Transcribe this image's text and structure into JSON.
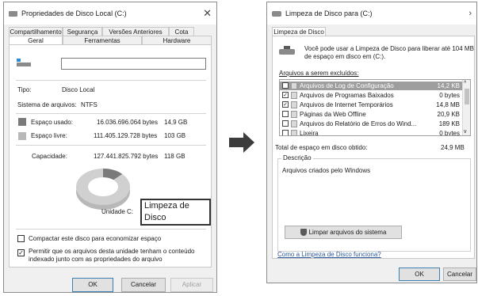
{
  "left": {
    "title": "Propriedades de Disco Local (C:)",
    "tabs_top": [
      "Compartilhamento",
      "Segurança",
      "Versões Anteriores",
      "Cota"
    ],
    "tabs_bottom": [
      "Geral",
      "Ferramentas",
      "Hardware"
    ],
    "type_label": "Tipo:",
    "type_value": "Disco Local",
    "fs_label": "Sistema de arquivos:",
    "fs_value": "NTFS",
    "used_label": "Espaço usado:",
    "used_bytes": "16.036.696.064 bytes",
    "used_gb": "14,9 GB",
    "free_label": "Espaço livre:",
    "free_bytes": "111.405.129.728 bytes",
    "free_gb": "103 GB",
    "cap_label": "Capacidade:",
    "cap_bytes": "127.441.825.792 bytes",
    "cap_gb": "118 GB",
    "unit_label": "Unidade C:",
    "cleanup_button": "Limpeza de Disco",
    "compress_label": "Compactar este disco para economizar espaço",
    "index_label_1": "Permitir que os arquivos desta unidade tenham o conteúdo",
    "index_label_2": "indexado junto com as propriedades do arquivo",
    "ok": "OK",
    "cancel": "Cancelar",
    "apply": "Aplicar"
  },
  "right": {
    "title": "Limpeza de Disco para  (C:)",
    "tab": "Limpeza de Disco",
    "intro_1": "Você pode usar a Limpeza de Disco para liberar até 104 MB",
    "intro_2": "de espaço em disco em  (C:).",
    "files_label": "Arquivos a serem excluídos:",
    "files": [
      {
        "name": "Arquivos de Log de Configuração",
        "size": "14,2 KB",
        "checked": false
      },
      {
        "name": "Arquivos de Programas Baixados",
        "size": "0 bytes",
        "checked": true
      },
      {
        "name": "Arquivos de Internet Temporários",
        "size": "14,8 MB",
        "checked": true
      },
      {
        "name": "Páginas da Web Offline",
        "size": "20,9 KB",
        "checked": false
      },
      {
        "name": "Arquivos do Relatório de Erros do Wind...",
        "size": "189 KB",
        "checked": false
      },
      {
        "name": "Lixeira",
        "size": "0 bytes",
        "checked": false
      }
    ],
    "total_label": "Total de espaço em disco obtido:",
    "total_value": "24,9 MB",
    "desc_label": "Descrição",
    "desc_text": "Arquivos criados pelo Windows",
    "clean_system_button": "Limpar arquivos do sistema",
    "help_link": "Como a Limpeza de Disco funciona?",
    "ok": "OK",
    "cancel": "Cancelar"
  },
  "colors": {
    "used": "#7a7a7a",
    "free": "#b8b8b8",
    "arrow": "#3c3c3c"
  },
  "disk_usage": {
    "used_fraction": 0.126
  }
}
